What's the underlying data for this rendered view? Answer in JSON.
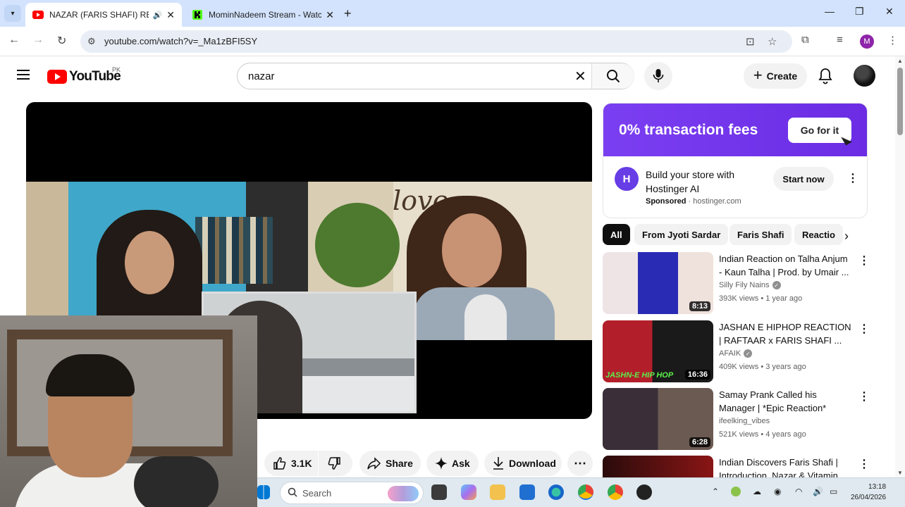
{
  "browser": {
    "tabs": [
      {
        "title": "NAZAR (FARIS SHAFI) REAC",
        "active": true,
        "audio": true
      },
      {
        "title": "MominNadeem Stream - Watc",
        "active": false
      }
    ],
    "url": "youtube.com/watch?v=_Ma1zBFI5SY",
    "profile_initial": "M"
  },
  "youtube": {
    "logo_text": "YouTube",
    "country": "PK",
    "search_query": "nazar",
    "create_label": "Create",
    "actions": {
      "likes": "3.1K",
      "share": "Share",
      "ask": "Ask",
      "download": "Download"
    },
    "ad": {
      "banner_text": "0% transaction fees",
      "banner_cta": "Go for it",
      "logo_letter": "H",
      "title": "Build your store with Hostinger AI",
      "sponsored": "Sponsored",
      "domain": "hostinger.com",
      "cta": "Start now"
    },
    "chips": [
      "All",
      "From Jyoti Sardar",
      "Faris Shafi",
      "Reactio"
    ],
    "recommendations": [
      {
        "title": "Indian Reaction on Talha Anjum - Kaun Talha | Prod. by Umair ...",
        "channel": "Silly Fily Nains",
        "verified": true,
        "views": "393K views",
        "age": "1 year ago",
        "duration": "8:13",
        "thumb_colors": [
          "#f0e8ea",
          "#2a2bb5"
        ]
      },
      {
        "title": "JASHAN E HIPHOP REACTION | RAFTAAR x FARIS SHAFI ...",
        "channel": "AFAIK",
        "verified": true,
        "views": "409K views",
        "age": "3 years ago",
        "duration": "16:36",
        "thumb_colors": [
          "#b21f2a",
          "#1a1a1a"
        ],
        "thumb_text": "JASHN-E HIP HOP"
      },
      {
        "title": "Samay Prank Called his Manager | *Epic Reaction*",
        "channel": "ifeelking_vibes",
        "verified": false,
        "views": "521K views",
        "age": "4 years ago",
        "duration": "6:28",
        "thumb_colors": [
          "#3a2f38",
          "#c9a58c"
        ]
      },
      {
        "title": "Indian Discovers Faris Shafi | Introduction, Nazar & Vitamin",
        "channel": "",
        "verified": false,
        "views": "",
        "age": "",
        "duration": "",
        "thumb_colors": [
          "#2a0b0b",
          "#8a1515"
        ]
      }
    ]
  },
  "taskbar": {
    "search_placeholder": "Search",
    "time": "13:18",
    "date": "26/04/2026"
  }
}
